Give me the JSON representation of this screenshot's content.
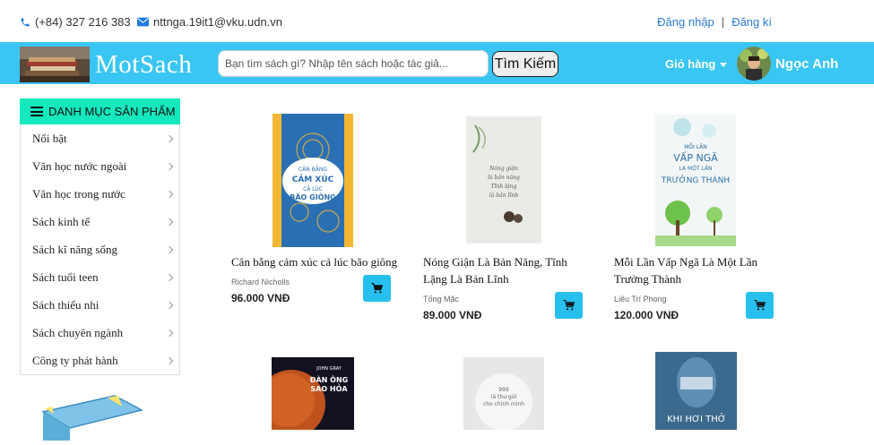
{
  "topbar": {
    "phone": "(+84) 327 216 383",
    "email": "nttnga.19it1@vku.udn.vn",
    "login_label": "Đăng nhập",
    "separator": "|",
    "register_label": "Đăng kí"
  },
  "header": {
    "brand": "MotSach",
    "search_placeholder": "Bạn tìm sách gì? Nhập tên sách hoặc tác giả...",
    "search_button": "Tìm Kiếm",
    "cart_label": "Giỏ hàng",
    "username": "Ngọc Anh"
  },
  "sidebar": {
    "title": "DANH MỤC SẢN PHẨM",
    "items": [
      {
        "label": "Nổi bật"
      },
      {
        "label": "Văn học nước ngoài"
      },
      {
        "label": "Văn học trong nước"
      },
      {
        "label": "Sách kinh tế"
      },
      {
        "label": "Sách kĩ năng sống"
      },
      {
        "label": "Sách tuổi teen"
      },
      {
        "label": "Sách thiếu nhi"
      },
      {
        "label": "Sách chuyên ngành"
      },
      {
        "label": "Công ty phát hành"
      }
    ]
  },
  "products": [
    {
      "title": "Cân bằng cảm xúc cả lúc bão giông",
      "author": "Richard Nicholls",
      "price": "96.000 VNĐ",
      "cover_text": "CÂN BẰNG CẢM XÚC CẢ LÚC BÃO GIÔNG",
      "cover_color": "#2a6fb3"
    },
    {
      "title": "Nóng Giận Là Bản Năng, Tĩnh Lặng Là Bản Lĩnh",
      "author": "Tống Mặc",
      "price": "89.000 VNĐ",
      "cover_text": "Nóng giận là bản năng Tĩnh lặng là bản lĩnh",
      "cover_color": "#e9ece6"
    },
    {
      "title": "Mỗi Lần Vấp Ngã Là Một Lần Trưởng Thành",
      "author": "Liêu Trí Phong",
      "price": "120.000 VNĐ",
      "cover_text": "MỖI LẦN VẤP NGÃ LÀ MỘT LẦN TRƯỞNG THÀNH",
      "cover_color": "#f3f6f7"
    },
    {
      "cover_text": "ĐÀN ÔNG SAO HỎA",
      "cover_author": "JOHN GRAY",
      "cover_color": "#1a1a2e"
    },
    {
      "cover_text": "999 lá thư gửi cho chính mình",
      "cover_color": "#e7e7ea"
    },
    {
      "cover_text": "KHI HƠI THỞ",
      "cover_color": "#3c6a8e"
    }
  ],
  "colors": {
    "header_bg": "#39c6f4",
    "sidebar_head_bg": "#14e8bd",
    "cart_button_bg": "#27c0ee",
    "link": "#2a7bd6"
  },
  "icons": [
    "phone-icon",
    "email-icon",
    "menu-icon",
    "chevron-right-icon",
    "cart-icon",
    "caret-down-icon"
  ]
}
